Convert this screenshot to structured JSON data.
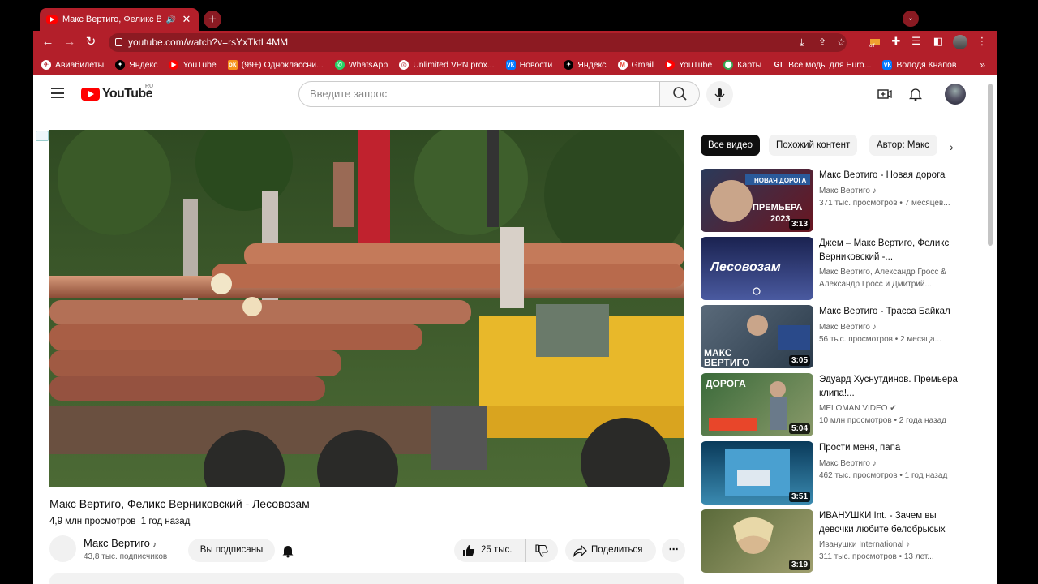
{
  "browser": {
    "tab_title": "Макс Вертиго, Феликс Вер",
    "tab_audio": "🔊",
    "tab_close": "✕",
    "new_tab": "+",
    "url": "youtube.com/watch?v=rsYxTktL4MM",
    "bookmarks": [
      {
        "label": "Авиабилеты"
      },
      {
        "label": "Яндекс"
      },
      {
        "label": "YouTube"
      },
      {
        "label": "(99+) Одноклассни..."
      },
      {
        "label": "WhatsApp"
      },
      {
        "label": "Unlimited VPN prox..."
      },
      {
        "label": "Новости"
      },
      {
        "label": "Яндекс"
      },
      {
        "label": "Gmail"
      },
      {
        "label": "YouTube"
      },
      {
        "label": "Карты"
      },
      {
        "label": "Все моды для Euro..."
      },
      {
        "label": "Володя Кнапов"
      }
    ],
    "bookmarks_more": "»",
    "ext_badge": "off"
  },
  "youtube": {
    "logo_text": "YouTube",
    "region": "RU",
    "search_placeholder": "Введите запрос",
    "video": {
      "title": "Макс Вертиго, Феликс Верниковский - Лесовозам",
      "views": "4,9 млн просмотров",
      "age": "1 год назад",
      "channel": "Макс Вертиго",
      "channel_note": "♪",
      "subscribers": "43,8 тыс. подписчиков",
      "subscribed_label": "Вы подписаны",
      "likes": "25 тыс.",
      "share_label": "Поделиться",
      "more": "⋯"
    },
    "chips": [
      "Все видео",
      "Похожий контент",
      "Автор: Макс"
    ],
    "chip_next": "›",
    "recommendations": [
      {
        "title": "Макс Вертиго - Новая дорога",
        "channel": "Макс Вертиго ♪",
        "meta": "371 тыс. просмотров • 7 месяцев...",
        "duration": "3:13",
        "thumb_text1": "НОВАЯ ДОРОГА",
        "thumb_text2": "ПРЕМЬЕРА",
        "thumb_text3": "2023"
      },
      {
        "title": "Джем – Макс Вертиго, Феликс Верниковский -...",
        "channel": "Макс Вертиго, Александр Гросс & Александр Гросс и Дмитрий...",
        "meta": "",
        "duration": "",
        "thumb_text1": "Лесовозам"
      },
      {
        "title": "Макс Вертиго - Трасса Байкал",
        "channel": "Макс Вертиго ♪",
        "meta": "56 тыс. просмотров • 2 месяца...",
        "duration": "3:05",
        "thumb_text1": "МАКС",
        "thumb_text2": "ВЕРТИГО"
      },
      {
        "title": "Эдуард Хуснутдинов. Премьера клипа!...",
        "channel": "MELOMAN VIDEO ✔",
        "meta": "10 млн просмотров • 2 года назад",
        "duration": "5:04",
        "thumb_text1": "ДОРОГА"
      },
      {
        "title": "Прости меня, папа",
        "channel": "Макс Вертиго ♪",
        "meta": "462 тыс. просмотров • 1 год назад",
        "duration": "3:51"
      },
      {
        "title": "ИВАНУШКИ Int. - Зачем вы девочки любите белобрысых",
        "channel": "Иванушки International ♪",
        "meta": "311 тыс. просмотров • 13 лет...",
        "duration": "3:19"
      }
    ]
  },
  "colors": {
    "chrome_theme": "#b31f2a",
    "yt_red": "#ff0000"
  }
}
